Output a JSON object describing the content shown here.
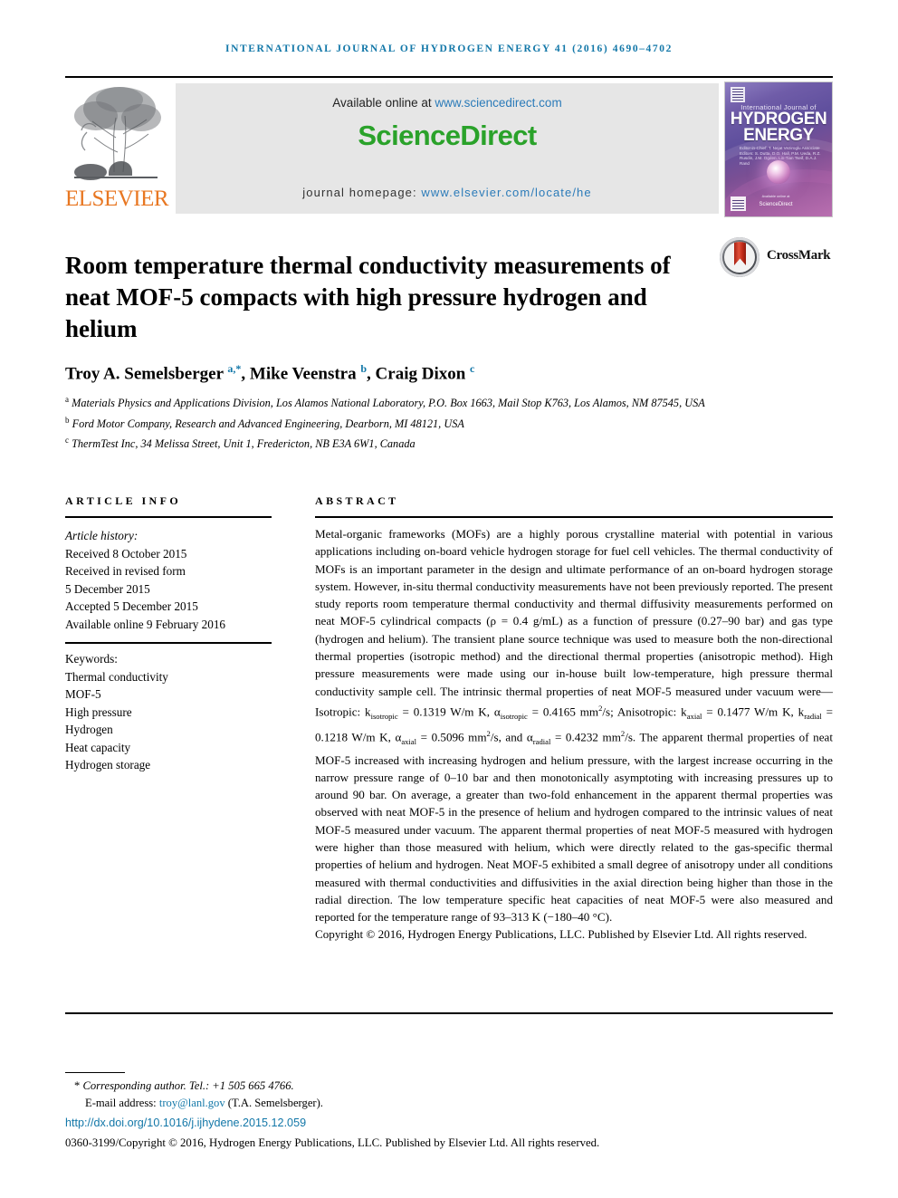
{
  "running_head": "International Journal of Hydrogen Energy 41 (2016) 4690–4702",
  "masthead": {
    "elsevier_wordmark": "ELSEVIER",
    "available_prefix": "Available online at ",
    "available_link": "www.sciencedirect.com",
    "sciencedirect_logo": "ScienceDirect",
    "homepage_prefix": "journal homepage: ",
    "homepage_link": "www.elsevier.com/locate/he",
    "cover": {
      "line_small": "International Journal of",
      "line_1": "HYDROGEN",
      "line_2": "ENERGY",
      "editors": "Editor-in-Chief: T. Nejat Veziroglu   Associate Editors: S. Dutta, D.O. Hall, P.M. Ueda, R.Z. Rusdin, J.M. Ogden, Lin-Tian Tseif, D.A.J. Rand",
      "publisher_note": "Available online at",
      "publisher": "ScienceDirect"
    }
  },
  "crossmark": {
    "label": "CrossMark"
  },
  "article": {
    "title": "Room temperature thermal conductivity measurements of neat MOF-5 compacts with high pressure hydrogen and helium",
    "authors_html": "Troy A. Semelsberger <sup>a,*</sup>, Mike Veenstra <sup>b</sup>, Craig Dixon <sup>c</sup>",
    "affiliations": [
      {
        "marker": "a",
        "text": "Materials Physics and Applications Division, Los Alamos National Laboratory, P.O. Box 1663, Mail Stop K763, Los Alamos, NM 87545, USA"
      },
      {
        "marker": "b",
        "text": "Ford Motor Company, Research and Advanced Engineering, Dearborn, MI 48121, USA"
      },
      {
        "marker": "c",
        "text": "ThermTest Inc, 34 Melissa Street, Unit 1, Fredericton, NB E3A 6W1, Canada"
      }
    ]
  },
  "article_info": {
    "heading": "ARTICLE INFO",
    "history_label": "Article history:",
    "history": [
      "Received 8 October 2015",
      "Received in revised form",
      "5 December 2015",
      "Accepted 5 December 2015",
      "Available online 9 February 2016"
    ],
    "keywords_label": "Keywords:",
    "keywords": [
      "Thermal conductivity",
      "MOF-5",
      "High pressure",
      "Hydrogen",
      "Heat capacity",
      "Hydrogen storage"
    ]
  },
  "abstract": {
    "heading": "ABSTRACT",
    "body_html": "Metal-organic frameworks (MOFs) are a highly porous crystalline material with potential in various applications including on-board vehicle hydrogen storage for fuel cell vehicles. The thermal conductivity of MOFs is an important parameter in the design and ultimate performance of an on-board hydrogen storage system. However, in-situ thermal conductivity measurements have not been previously reported. The present study reports room temperature thermal conductivity and thermal diffusivity measurements performed on neat MOF-5 cylindrical compacts (ρ = 0.4 g/mL) as a function of pressure (0.27–90 bar) and gas type (hydrogen and helium). The transient plane source technique was used to measure both the non-directional thermal properties (isotropic method) and the directional thermal properties (anisotropic method). High pressure measurements were made using our in-house built low-temperature, high pressure thermal conductivity sample cell. The intrinsic thermal properties of neat MOF-5 measured under vacuum were—Isotropic: k<sub>isotropic</sub> = 0.1319 W/m K, α<sub>isotropic</sub> = 0.4165 mm<sup>2</sup>/s; Anisotropic: k<sub>axial</sub> = 0.1477 W/m K, k<sub>radial</sub> = 0.1218 W/m K, α<sub>axial</sub> = 0.5096 mm<sup>2</sup>/s, and α<sub>radial</sub> = 0.4232 mm<sup>2</sup>/s. The apparent thermal properties of neat MOF-5 increased with increasing hydrogen and helium pressure, with the largest increase occurring in the narrow pressure range of 0–10 bar and then monotonically asymptoting with increasing pressures up to around 90 bar. On average, a greater than two-fold enhancement in the apparent thermal properties was observed with neat MOF-5 in the presence of helium and hydrogen compared to the intrinsic values of neat MOF-5 measured under vacuum. The apparent thermal properties of neat MOF-5 measured with hydrogen were higher than those measured with helium, which were directly related to the gas-specific thermal properties of helium and hydrogen. Neat MOF-5 exhibited a small degree of anisotropy under all conditions measured with thermal conductivities and diffusivities in the axial direction being higher than those in the radial direction. The low temperature specific heat capacities of neat MOF-5 were also measured and reported for the temperature range of 93–313 K (−180–40 °C).",
    "copyright": "Copyright © 2016, Hydrogen Energy Publications, LLC. Published by Elsevier Ltd. All rights reserved."
  },
  "footer": {
    "corresponding_star": "*",
    "corresponding": " Corresponding author. Tel.: +1 505 665 4766.",
    "email_label": "E-mail address: ",
    "email": "troy@lanl.gov",
    "email_suffix": " (T.A. Semelsberger).",
    "doi": "http://dx.doi.org/10.1016/j.ijhydene.2015.12.059",
    "issn_line": "0360-3199/Copyright © 2016, Hydrogen Energy Publications, LLC. Published by Elsevier Ltd. All rights reserved."
  },
  "colors": {
    "journal_blue": "#1277a8",
    "link_blue": "#2b7bb9",
    "sciencedirect_green": "#2aa22a",
    "elsevier_orange": "#E87722",
    "crossmark_red": "#c02a18"
  }
}
